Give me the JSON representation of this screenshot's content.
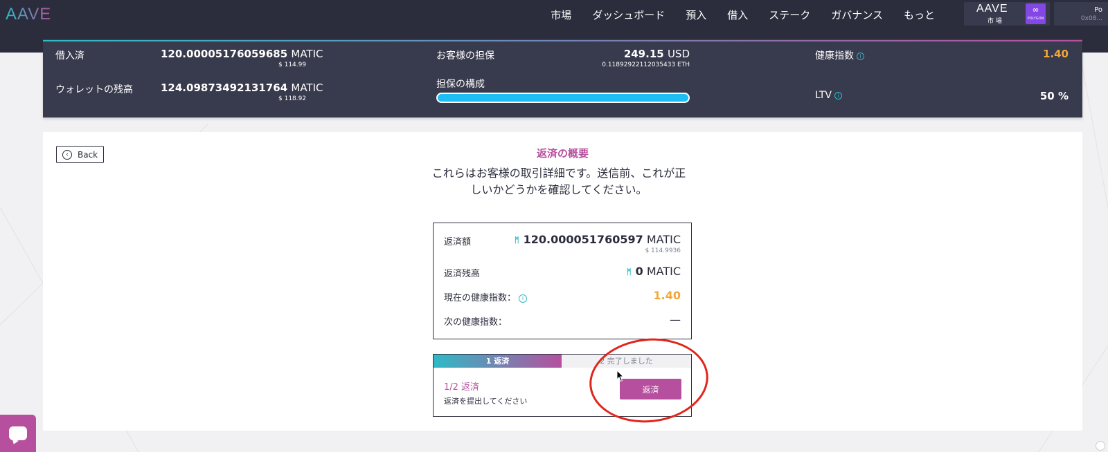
{
  "nav": {
    "logo": "AAVE",
    "items": [
      "市場",
      "ダッシュボード",
      "預入",
      "借入",
      "ステーク",
      "ガバナンス",
      "もっと"
    ],
    "market": {
      "name": "AAVE",
      "sub": "市 場",
      "network_badge": "POLYGON"
    },
    "account": {
      "network": "Po",
      "address": "0x08..."
    }
  },
  "info": {
    "borrowed_label": "借入済",
    "borrowed_value": "120.00005176059685",
    "borrowed_unit": "MATIC",
    "borrowed_usd": "$ 114.99",
    "wallet_label": "ウォレットの残高",
    "wallet_value": "124.09873492131764",
    "wallet_unit": "MATIC",
    "wallet_usd": "$ 118.92",
    "collateral_label": "お客様の担保",
    "collateral_value": "249.15",
    "collateral_unit": "USD",
    "collateral_eth": "0.11892922112035433  ETH",
    "composition_label": "担保の構成",
    "health_label": "健康指数",
    "health_value": "1.40",
    "ltv_label": "LTV",
    "ltv_value": "50 %",
    "collateral_composition_pct": 100
  },
  "main": {
    "back_label": "Back",
    "title": "返済の概要",
    "description": "これらはお客様の取引詳細です。送信前、これが正しいかどうかを確認してください。",
    "rows": {
      "amount_label": "返済額",
      "amount_value": "120.000051760597",
      "amount_unit": "MATIC",
      "amount_usd": "$ 114.9936",
      "remaining_label": "返済残高",
      "remaining_value": "0",
      "remaining_unit": "MATIC",
      "current_health_label": "現在の健康指数：",
      "current_health_value": "1.40",
      "next_health_label": "次の健康指数：",
      "next_health_value": "—"
    },
    "steps": {
      "step1": "1  返済",
      "step2": "2  完了しました",
      "title": "1/2 返済",
      "desc": "返済を提出してください",
      "button": "返済"
    }
  },
  "colors": {
    "brand_pink": "#b6509e",
    "brand_teal": "#2ebac6",
    "dark": "#2b2d3c",
    "panel": "#383a4d",
    "orange": "#f0a73b",
    "annotation_red": "#e0261c"
  }
}
